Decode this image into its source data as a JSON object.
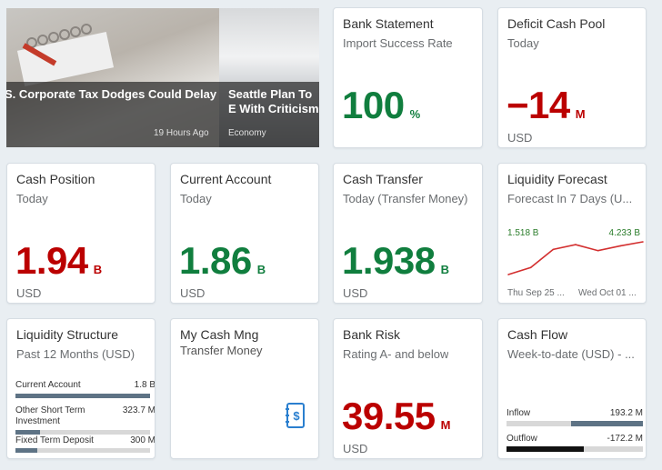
{
  "news": [
    {
      "headline": "S. Corporate Tax Dodges Could Delay",
      "time": "19 Hours Ago",
      "category": "Economy"
    },
    {
      "headline": "Seattle Plan To E With Criticism",
      "category": "Economy"
    }
  ],
  "tiles": {
    "bank_statement": {
      "title": "Bank Statement",
      "subtitle": "Import Success Rate",
      "value": "100",
      "scale": "%"
    },
    "deficit_cash_pool": {
      "title": "Deficit Cash Pool",
      "subtitle": "Today",
      "value": "−14",
      "scale": "M",
      "unit": "USD"
    },
    "cash_position": {
      "title": "Cash Position",
      "subtitle": "Today",
      "value": "1.94",
      "scale": "B",
      "unit": "USD"
    },
    "current_account": {
      "title": "Current Account",
      "subtitle": "Today",
      "value": "1.86",
      "scale": "B",
      "unit": "USD"
    },
    "cash_transfer": {
      "title": "Cash Transfer",
      "subtitle": "Today (Transfer Money)",
      "value": "1.938",
      "scale": "B",
      "unit": "USD"
    },
    "liquidity_forecast": {
      "title": "Liquidity Forecast",
      "subtitle": "Forecast In 7 Days (U...",
      "start_label": "1.518 B",
      "end_label": "4.233 B",
      "x_start": "Thu Sep 25 ...",
      "x_end": "Wed Oct 01 ...",
      "points": [
        1.518,
        2.1,
        3.6,
        4.0,
        3.5,
        3.9,
        4.233
      ],
      "line_color": "#d32f2f"
    },
    "liquidity_structure": {
      "title": "Liquidity Structure",
      "subtitle": "Past 12 Months (USD)",
      "rows": [
        {
          "name": "Current Account",
          "value": "1.8 B",
          "fraction": 1.0
        },
        {
          "name": "Other Short Term Investment",
          "value": "323.7 M",
          "fraction": 0.18
        },
        {
          "name": "Fixed Term Deposit",
          "value": "300 M",
          "fraction": 0.16
        }
      ]
    },
    "my_cash_mng": {
      "title": "My Cash Mng",
      "subtitle": "Transfer Money",
      "icon": "dollar-document-icon"
    },
    "bank_risk": {
      "title": "Bank Risk",
      "subtitle": "Rating A- and below",
      "value": "39.55",
      "scale": "M",
      "unit": "USD"
    },
    "cash_flow": {
      "title": "Cash Flow",
      "subtitle": "Week-to-date (USD) - ...",
      "inflow_label": "Inflow",
      "inflow_value": "193.2 M",
      "outflow_label": "Outflow",
      "outflow_value": "-172.2 M",
      "inflow_fraction": 0.53,
      "outflow_fraction": 0.47
    }
  },
  "colors": {
    "positive": "#107e3e",
    "negative": "#bb0000",
    "neutral_bar": "#5e7385"
  }
}
